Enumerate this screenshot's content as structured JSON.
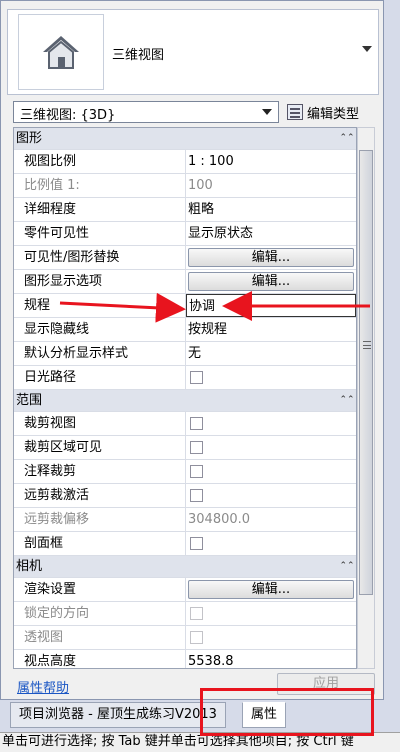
{
  "type_selector": {
    "name": "三维视图",
    "icon": "house-icon"
  },
  "view_selector": {
    "value": "三维视图: {3D}"
  },
  "edit_type": {
    "label": "编辑类型"
  },
  "groups": {
    "graphics": "图形",
    "extents": "范围",
    "camera": "相机"
  },
  "rows": {
    "view_scale": {
      "label": "视图比例",
      "value": "1 : 100"
    },
    "scale_value": {
      "label": "比例值 1:",
      "value": "100"
    },
    "detail_level": {
      "label": "详细程度",
      "value": "粗略"
    },
    "parts_visibility": {
      "label": "零件可见性",
      "value": "显示原状态"
    },
    "vg_overrides": {
      "label": "可见性/图形替换",
      "button": "编辑..."
    },
    "graphic_display": {
      "label": "图形显示选项",
      "button": "编辑..."
    },
    "discipline": {
      "label": "规程",
      "value": "协调"
    },
    "show_hidden_lines": {
      "label": "显示隐藏线",
      "value": "按规程"
    },
    "analysis_style": {
      "label": "默认分析显示样式",
      "value": "无"
    },
    "sun_path": {
      "label": "日光路径"
    },
    "crop_view": {
      "label": "裁剪视图"
    },
    "crop_region_visible": {
      "label": "裁剪区域可见"
    },
    "annotation_crop": {
      "label": "注释裁剪"
    },
    "far_clip_active": {
      "label": "远剪裁激活"
    },
    "far_clip_offset": {
      "label": "远剪裁偏移",
      "value": "304800.0"
    },
    "section_box": {
      "label": "剖面框"
    },
    "render_settings": {
      "label": "渲染设置",
      "button": "编辑..."
    },
    "locked_orientation": {
      "label": "锁定的方向"
    },
    "perspective": {
      "label": "透视图"
    },
    "eye_elevation": {
      "label": "视点高度",
      "value": "5538.8"
    }
  },
  "footer": {
    "help_link": "属性帮助",
    "apply": "应用"
  },
  "tabs": {
    "project_browser": "项目浏览器 - 屋顶生成练习V2013",
    "properties": "属性"
  },
  "status_bar": {
    "text": "单击可进行选择; 按 Tab 键并单击可选择其他项目; 按 Ctrl 键"
  },
  "colors": {
    "annotation_red": "#e8141e",
    "group_header": "#dfe3ec",
    "link_blue": "#1a56c4"
  }
}
